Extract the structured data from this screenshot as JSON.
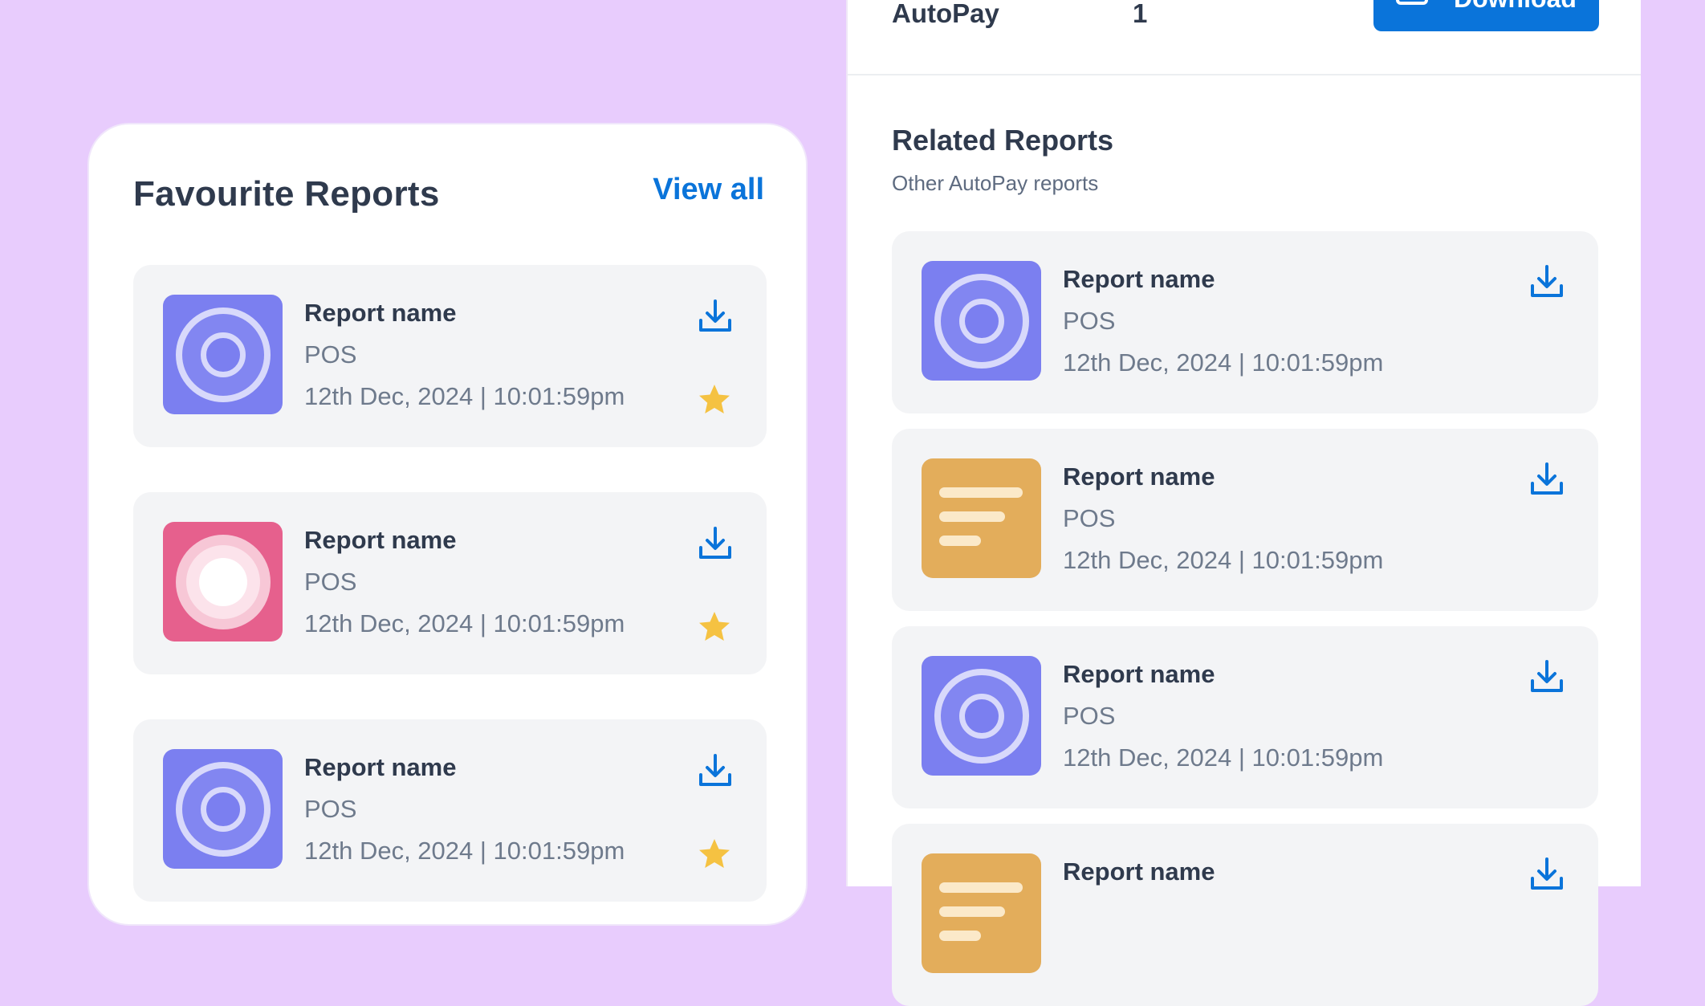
{
  "favourites": {
    "title": "Favourite Reports",
    "view_all": "View all",
    "items": [
      {
        "name": "Report name",
        "type": "POS",
        "date": "12th Dec, 2024 | 10:01:59pm",
        "thumb": "purple-target"
      },
      {
        "name": "Report name",
        "type": "POS",
        "date": "12th Dec, 2024 | 10:01:59pm",
        "thumb": "pink-circle"
      },
      {
        "name": "Report name",
        "type": "POS",
        "date": "12th Dec, 2024 | 10:01:59pm",
        "thumb": "purple-target"
      }
    ]
  },
  "summary": {
    "label": "AutoPay",
    "count": "1",
    "download_label": "Download"
  },
  "related": {
    "title": "Related Reports",
    "subtitle": "Other AutoPay reports",
    "items": [
      {
        "name": "Report name",
        "type": "POS",
        "date": "12th Dec, 2024 | 10:01:59pm",
        "thumb": "purple-target"
      },
      {
        "name": "Report name",
        "type": "POS",
        "date": "12th Dec, 2024 | 10:01:59pm",
        "thumb": "orange-document"
      },
      {
        "name": "Report name",
        "type": "POS",
        "date": "12th Dec, 2024 | 10:01:59pm",
        "thumb": "purple-target"
      },
      {
        "name": "Report name",
        "type": "",
        "date": "",
        "thumb": "orange-document"
      }
    ]
  },
  "colors": {
    "background": "#e8ccfd",
    "accent": "#0a74da",
    "card": "#f3f4f6",
    "star": "#f5c242"
  },
  "icons": [
    "download-icon",
    "star-icon",
    "report-thumbnail-icon"
  ]
}
